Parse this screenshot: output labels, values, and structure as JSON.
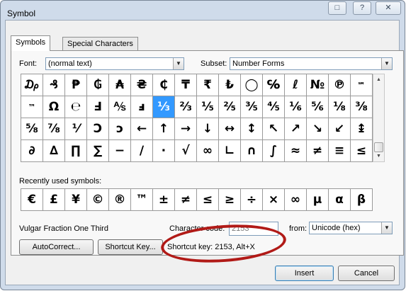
{
  "window": {
    "title": "Symbol",
    "caption_buttons": [
      "□",
      "?",
      "✕"
    ]
  },
  "tabs": [
    {
      "label": "Symbols",
      "active": true
    },
    {
      "label": "Special Characters",
      "active": false
    }
  ],
  "font": {
    "label": "Font:",
    "value": "(normal text)"
  },
  "subset": {
    "label": "Subset:",
    "value": "Number Forms"
  },
  "symbols_grid": [
    [
      "₯",
      "₰",
      "₱",
      "₲",
      "₳",
      "₴",
      "₵",
      "₸",
      "₹",
      "₺",
      "◯",
      "℅",
      "ℓ",
      "№",
      "℗",
      "℠"
    ],
    [
      "™",
      "Ω",
      "℮",
      "Ⅎ",
      "⅍",
      "ⅎ",
      "⅓",
      "⅔",
      "⅕",
      "⅖",
      "⅗",
      "⅘",
      "⅙",
      "⅚",
      "⅛",
      "⅜"
    ],
    [
      "⅝",
      "⅞",
      "⅟",
      "Ↄ",
      "ↄ",
      "←",
      "↑",
      "→",
      "↓",
      "↔",
      "↕",
      "↖",
      "↗",
      "↘",
      "↙",
      "↨"
    ],
    [
      "∂",
      "∆",
      "∏",
      "∑",
      "−",
      "∕",
      "∙",
      "√",
      "∞",
      "∟",
      "∩",
      "∫",
      "≈",
      "≠",
      "≡",
      "≤"
    ]
  ],
  "selected_symbol": "⅓",
  "recent_label": "Recently used symbols:",
  "recent_symbols": [
    "€",
    "£",
    "¥",
    "©",
    "®",
    "™",
    "±",
    "≠",
    "≤",
    "≥",
    "÷",
    "×",
    "∞",
    "µ",
    "α",
    "β"
  ],
  "character_name": "Vulgar Fraction One Third",
  "character_code": {
    "label": "Character code:",
    "value": "2153"
  },
  "from": {
    "label": "from:",
    "value": "Unicode (hex)"
  },
  "buttons": {
    "autocorrect": "AutoCorrect...",
    "shortcut_key": "Shortcut Key...",
    "insert": "Insert",
    "cancel": "Cancel"
  },
  "shortcut_text": "Shortcut key: 2153, Alt+X",
  "colors": {
    "selection": "#3399ff",
    "annotation_ellipse": "#b11a17",
    "window_frame": "#cfdbea"
  }
}
